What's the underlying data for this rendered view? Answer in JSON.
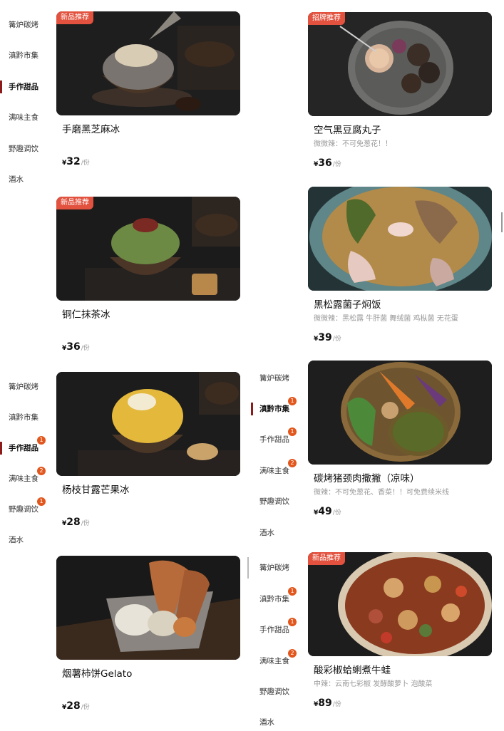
{
  "sidebar_top": {
    "items": [
      {
        "label": "篝炉碳烤",
        "active": false,
        "badge": ""
      },
      {
        "label": "滇黔市集",
        "active": false,
        "badge": ""
      },
      {
        "label": "手作甜品",
        "active": true,
        "badge": ""
      },
      {
        "label": "满味主食",
        "active": false,
        "badge": ""
      },
      {
        "label": "野趣调饮",
        "active": false,
        "badge": ""
      },
      {
        "label": "酒水",
        "active": false,
        "badge": ""
      }
    ]
  },
  "sidebar_middle": {
    "items": [
      {
        "label": "篝炉碳烤",
        "active": false,
        "badge": ""
      },
      {
        "label": "滇黔市集",
        "active": false,
        "badge": ""
      },
      {
        "label": "手作甜品",
        "active": true,
        "badge": "1"
      },
      {
        "label": "满味主食",
        "active": false,
        "badge": "2"
      },
      {
        "label": "野趣调饮",
        "active": false,
        "badge": "1"
      },
      {
        "label": "酒水",
        "active": false,
        "badge": ""
      }
    ]
  },
  "sidebar_right_a": {
    "items": [
      {
        "label": "篝炉碳烤",
        "active": false,
        "badge": ""
      },
      {
        "label": "滇黔市集",
        "active": true,
        "badge": "1"
      },
      {
        "label": "手作甜品",
        "active": false,
        "badge": "1"
      },
      {
        "label": "满味主食",
        "active": false,
        "badge": "2"
      },
      {
        "label": "野趣调饮",
        "active": false,
        "badge": ""
      },
      {
        "label": "酒水",
        "active": false,
        "badge": ""
      }
    ]
  },
  "sidebar_right_b": {
    "items": [
      {
        "label": "篝炉碳烤",
        "active": false,
        "badge": ""
      },
      {
        "label": "滇黔市集",
        "active": false,
        "badge": "1"
      },
      {
        "label": "手作甜品",
        "active": false,
        "badge": "1"
      },
      {
        "label": "满味主食",
        "active": false,
        "badge": "2"
      },
      {
        "label": "野趣调饮",
        "active": false,
        "badge": ""
      },
      {
        "label": "酒水",
        "active": false,
        "badge": ""
      }
    ]
  },
  "dishes": [
    {
      "tag": "新品推荐",
      "name": "手磨黑芝麻冰",
      "desc": "",
      "currency": "¥",
      "price": "32",
      "unit": "/份"
    },
    {
      "tag": "新品推荐",
      "name": "铜仁抹茶冰",
      "desc": "",
      "currency": "¥",
      "price": "36",
      "unit": "/份"
    },
    {
      "tag": "",
      "name": "杨枝甘露芒果冰",
      "desc": "",
      "currency": "¥",
      "price": "28",
      "unit": "/份"
    },
    {
      "tag": "",
      "name": "烟薯柿饼Gelato",
      "desc": "",
      "currency": "¥",
      "price": "28",
      "unit": "/份"
    },
    {
      "tag": "招牌推荐",
      "name": "空气黑豆腐丸子",
      "desc": "微微辣：不可免葱花！！",
      "currency": "¥",
      "price": "36",
      "unit": "/份"
    },
    {
      "tag": "",
      "name": "黑松露菌子焖饭",
      "desc": "微微辣：黑松露 牛肝菌 舞绒菌 鸡枞菌 无花蛋",
      "currency": "¥",
      "price": "39",
      "unit": "/份"
    },
    {
      "tag": "",
      "name": "碳烤猪颈肉撒撇（凉味）",
      "desc": "微辣：不可免葱花、香菜！！可免费续米线",
      "currency": "¥",
      "price": "49",
      "unit": "/份"
    },
    {
      "tag": "新品推荐",
      "name": "酸彩椒蛤蜊煮牛蛙",
      "desc": "中辣：云南七彩椒 发酵酸萝卜 泡酸菜",
      "currency": "¥",
      "price": "89",
      "unit": "/份"
    }
  ],
  "image_icons": [
    "black-sesame-ice-image",
    "matcha-ice-image",
    "mango-ice-image",
    "sweet-potato-gelato-image",
    "black-tofu-balls-image",
    "truffle-rice-image",
    "pork-neck-sapie-image",
    "bullfrog-clam-image"
  ],
  "colors": {
    "tag": "#e2523f",
    "badge": "#e2571d",
    "active_bar": "#8c1b1b"
  }
}
